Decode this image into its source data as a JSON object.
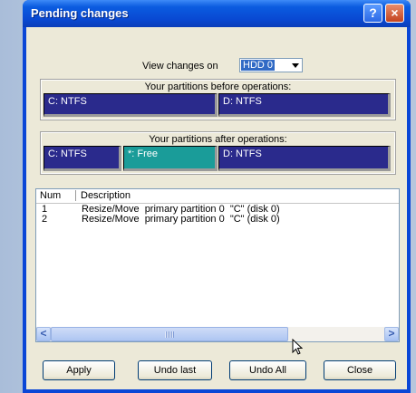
{
  "window": {
    "title": "Pending changes"
  },
  "titlebar": {
    "help_glyph": "?",
    "close_glyph": "×"
  },
  "view": {
    "label": "View changes on",
    "selected": "HDD 0"
  },
  "before": {
    "heading": "Your partitions before operations:",
    "partitions": [
      "C: NTFS",
      "D: NTFS"
    ]
  },
  "after": {
    "heading": "Your partitions after operations:",
    "partitions": [
      "C: NTFS",
      "*: Free",
      "D: NTFS"
    ]
  },
  "list": {
    "columns": [
      "Num",
      "Description"
    ],
    "rows": [
      {
        "num": "1",
        "desc": "Resize/Move  primary partition 0  \"C\" (disk 0)"
      },
      {
        "num": "2",
        "desc": "Resize/Move  primary partition 0  \"C\" (disk 0)"
      }
    ]
  },
  "scroll": {
    "left": "<",
    "right": ">"
  },
  "buttons": {
    "apply": "Apply",
    "undo_last": "Undo last",
    "undo_all": "Undo All",
    "close": "Close"
  },
  "colors": {
    "partition_used": "#2a2a8c",
    "partition_free": "#1a9c99",
    "title_bar": "#0949d3"
  }
}
